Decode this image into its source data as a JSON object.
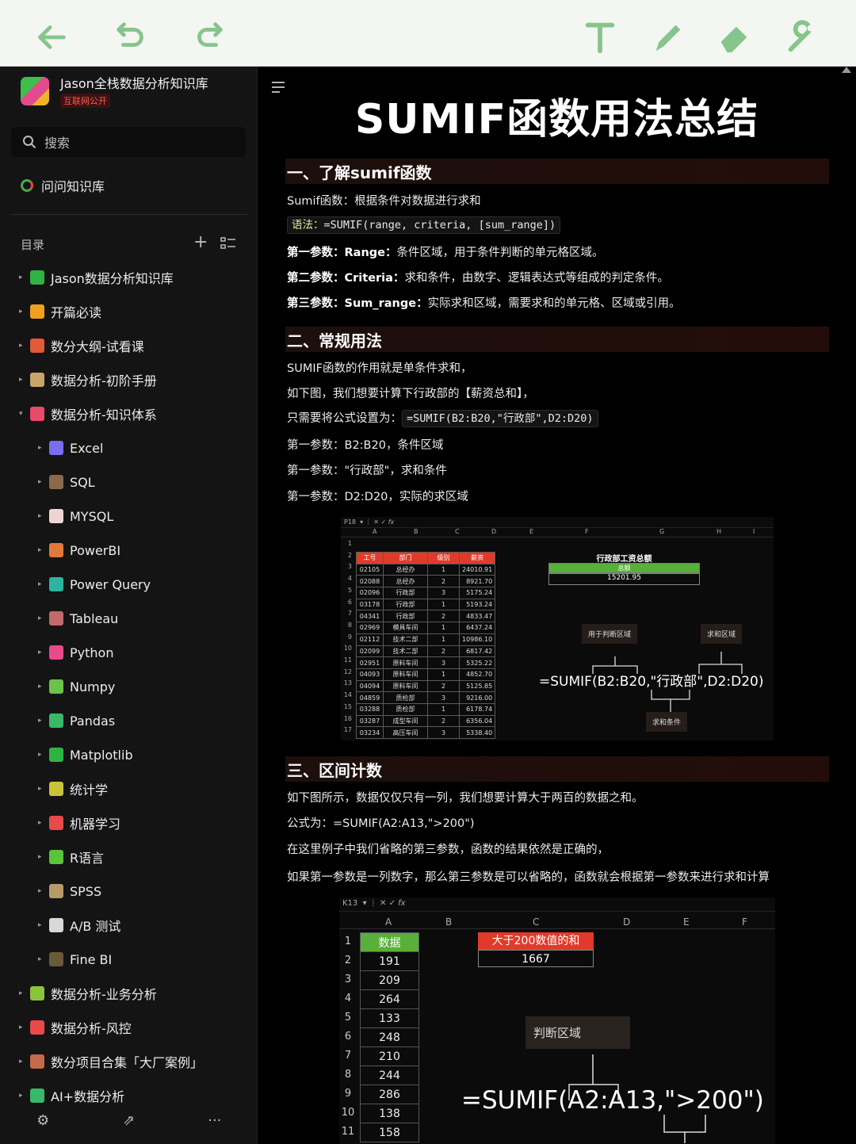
{
  "toolbar": {
    "icons": [
      "back-arrow-icon",
      "undo-icon",
      "redo-icon",
      "text-tool-icon",
      "pen-icon",
      "eraser-icon",
      "wrench-icon"
    ],
    "accent": "#86c58c"
  },
  "sidebar": {
    "kb_title": "Jason全栈数据分析知识库",
    "kb_badge": "互联网公开",
    "search_label": "搜索",
    "ask_label": "问问知识库",
    "toc_label": "目录",
    "toc_add": "+",
    "items": [
      {
        "label": "Jason数据分析知识库",
        "icon": "folder-icon",
        "color": "#2fb344",
        "level": 0,
        "caret": "▸"
      },
      {
        "label": "开篇必读",
        "icon": "book-icon",
        "color": "#f0a020",
        "level": 0,
        "caret": "▸"
      },
      {
        "label": "数分大纲-试看课",
        "icon": "gem-icon",
        "color": "#e05a3a",
        "level": 0,
        "caret": "▸"
      },
      {
        "label": "数据分析-初阶手册",
        "icon": "hourglass-icon",
        "color": "#c8a46a",
        "level": 0,
        "caret": "▸"
      },
      {
        "label": "数据分析-知识体系",
        "icon": "music-icon",
        "color": "#e84a6a",
        "level": 0,
        "caret": "▾"
      },
      {
        "label": "Excel",
        "icon": "excel-icon",
        "color": "#7b6cf0",
        "level": 1,
        "caret": "▸"
      },
      {
        "label": "SQL",
        "icon": "sql-icon",
        "color": "#8a6a4a",
        "level": 1,
        "caret": "▸"
      },
      {
        "label": "MYSQL",
        "icon": "mysql-icon",
        "color": "#f0d4d4",
        "level": 1,
        "caret": "▸"
      },
      {
        "label": "PowerBI",
        "icon": "powerbi-icon",
        "color": "#e07a3a",
        "level": 1,
        "caret": "▸"
      },
      {
        "label": "Power Query",
        "icon": "powerquery-icon",
        "color": "#2fb3a0",
        "level": 1,
        "caret": "▸"
      },
      {
        "label": "Tableau",
        "icon": "tableau-icon",
        "color": "#c46a6a",
        "level": 1,
        "caret": "▸"
      },
      {
        "label": "Python",
        "icon": "python-icon",
        "color": "#e84a8a",
        "level": 1,
        "caret": "▸"
      },
      {
        "label": "Numpy",
        "icon": "numpy-icon",
        "color": "#6ac44a",
        "level": 1,
        "caret": "▸"
      },
      {
        "label": "Pandas",
        "icon": "pandas-icon",
        "color": "#3ab86a",
        "level": 1,
        "caret": "▸"
      },
      {
        "label": "Matplotlib",
        "icon": "matplotlib-icon",
        "color": "#2fb344",
        "level": 1,
        "caret": "▸"
      },
      {
        "label": "统计学",
        "icon": "stats-icon",
        "color": "#c8c43a",
        "level": 1,
        "caret": "▸"
      },
      {
        "label": "机器学习",
        "icon": "robot-icon",
        "color": "#e84a4a",
        "level": 1,
        "caret": "▸"
      },
      {
        "label": "R语言",
        "icon": "r-icon",
        "color": "#5ac43a",
        "level": 1,
        "caret": "▸"
      },
      {
        "label": "SPSS",
        "icon": "spss-icon",
        "color": "#b89a6a",
        "level": 1,
        "caret": "▸"
      },
      {
        "label": "A/B 测试",
        "icon": "ab-icon",
        "color": "#d8d8d8",
        "level": 1,
        "caret": "▸"
      },
      {
        "label": "Fine BI",
        "icon": "finebi-icon",
        "color": "#6a5a3a",
        "level": 1,
        "caret": "▸"
      },
      {
        "label": "数据分析-业务分析",
        "icon": "business-icon",
        "color": "#8ac43a",
        "level": 0,
        "caret": "▸"
      },
      {
        "label": "数据分析-风控",
        "icon": "shield-icon",
        "color": "#e84a4a",
        "level": 0,
        "caret": "▸"
      },
      {
        "label": "数分项目合集「大厂案例」",
        "icon": "link-icon",
        "color": "#c46a4a",
        "level": 0,
        "caret": "▸"
      },
      {
        "label": "AI+数据分析",
        "icon": "ai-icon",
        "color": "#3ab86a",
        "level": 0,
        "caret": "▸"
      }
    ],
    "footer": [
      "⚙",
      "⇗",
      "···"
    ]
  },
  "main": {
    "title": "SUMIF函数用法总结",
    "s1": {
      "heading": "一、了解sumif函数",
      "l1": "Sumif函数：根据条件对数据进行求和",
      "syntax_label": "语法：",
      "syntax": "=SUMIF(range, criteria, [sum_range])",
      "p1_b": "第一参数：Range：",
      "p1": "条件区域，用于条件判断的单元格区域。",
      "p2_b": "第二参数：Criteria：",
      "p2": "求和条件，由数字、逻辑表达式等组成的判定条件。",
      "p3_b": "第三参数：Sum_range：",
      "p3": "实际求和区域，需要求和的单元格、区域或引用。"
    },
    "s2": {
      "heading": "二、常规用法",
      "l1": "SUMIF函数的作用就是单条件求和，",
      "l2": "如下图，我们想要计算下行政部的【薪资总和】，",
      "l3": "只需要将公式设置为：",
      "l3_code": "=SUMIF(B2:B20,\"行政部\",D2:D20)",
      "l4": "第一参数：B2:B20，条件区域",
      "l5": "第一参数：\"行政部\"，求和条件",
      "l6": "第一参数：D2:D20，实际的求区域"
    },
    "xl1": {
      "namebox": "P18",
      "cols": [
        "A",
        "B",
        "C",
        "D",
        "E",
        "F",
        "G",
        "H",
        "I"
      ],
      "headers": [
        "工号",
        "部门",
        "级别",
        "薪资"
      ],
      "rows": [
        [
          "02105",
          "总经办",
          "1",
          "24010.91"
        ],
        [
          "02088",
          "总经办",
          "2",
          "8921.70"
        ],
        [
          "02096",
          "行政部",
          "3",
          "5175.24"
        ],
        [
          "03178",
          "行政部",
          "1",
          "5193.24"
        ],
        [
          "04341",
          "行政部",
          "2",
          "4833.47"
        ],
        [
          "02969",
          "模具车间",
          "1",
          "6437.24"
        ],
        [
          "02112",
          "技术二部",
          "1",
          "10986.10"
        ],
        [
          "02099",
          "技术二部",
          "2",
          "6817.42"
        ],
        [
          "02951",
          "原料车间",
          "3",
          "5325.22"
        ],
        [
          "04093",
          "原料车间",
          "1",
          "4852.70"
        ],
        [
          "04094",
          "原料车间",
          "2",
          "5125.85"
        ],
        [
          "04859",
          "质检部",
          "3",
          "9216.00"
        ],
        [
          "03288",
          "质检部",
          "1",
          "6178.74"
        ],
        [
          "03287",
          "成型车间",
          "2",
          "6356.04"
        ],
        [
          "03234",
          "高压车间",
          "3",
          "5338.40"
        ]
      ],
      "sum_title": "行政部工资总额",
      "sum_label": "总额",
      "sum_value": "15201.95",
      "tag_cond_range": "用于判断区域",
      "tag_sum_range": "求和区域",
      "tag_criteria": "求和条件",
      "formula": "=SUMIF(B2:B20,\"行政部\",D2:D20)"
    },
    "s3": {
      "heading": "三、区间计数",
      "l1": "如下图所示，数据仅仅只有一列，我们想要计算大于两百的数据之和。",
      "l2": "公式为：=SUMIF(A2:A13,\">200\")",
      "l3": "在这里例子中我们省略的第三参数，函数的结果依然是正确的，",
      "l4": "如果第一参数是一列数字，那么第三参数是可以省略的，函数就会根据第一参数来进行求和计算"
    },
    "xl2": {
      "namebox": "K13",
      "cols": [
        "A",
        "B",
        "C",
        "D",
        "E",
        "F"
      ],
      "header": "数据",
      "values": [
        "191",
        "209",
        "264",
        "133",
        "248",
        "210",
        "244",
        "286",
        "138",
        "158"
      ],
      "result_header": "大于200数值的和",
      "result_value": "1667",
      "tag": "判断区域",
      "formula": "=SUMIF(A2:A13,\">200\")"
    }
  }
}
